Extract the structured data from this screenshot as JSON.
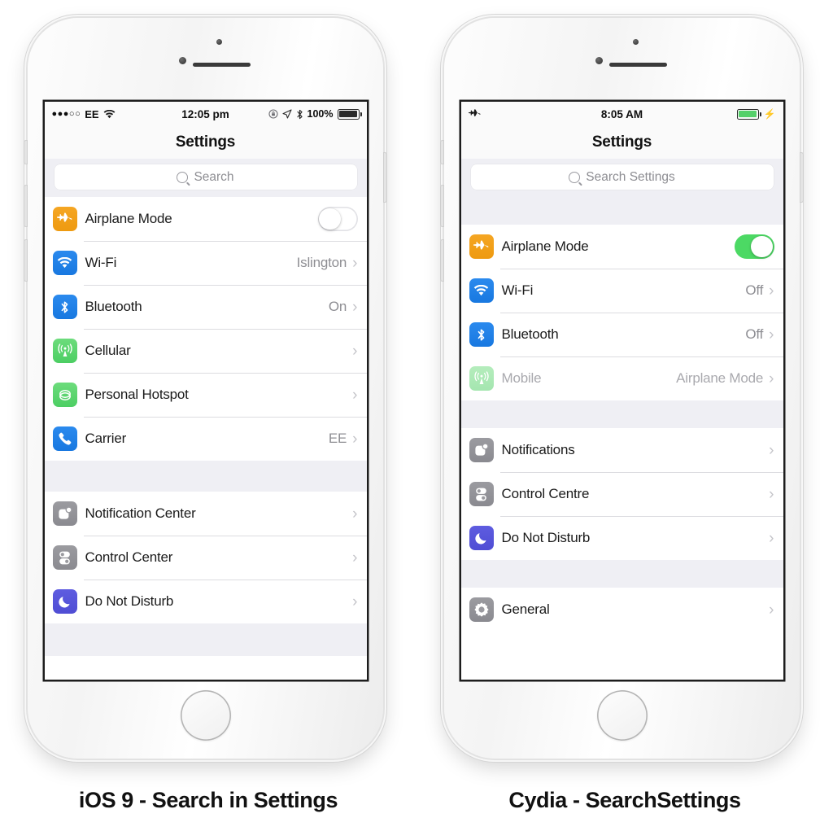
{
  "phones": [
    {
      "id": "left-phone",
      "caption": "iOS 9 - Search in Settings",
      "status_bar": {
        "signal_dots": "●●●○○",
        "carrier": "EE",
        "wifi_icon": "wifi-icon",
        "time": "12:05 pm",
        "rotation_lock_icon": "rotation-lock-icon",
        "location_icon": "location-arrow-icon",
        "bluetooth_icon": "bluetooth-icon",
        "battery_percent": "100%",
        "battery_icon": "battery-full-icon",
        "battery_color": "#2a2a2a",
        "charging": false
      },
      "nav_title": "Settings",
      "search": {
        "placeholder": "Search",
        "value": "",
        "icon": "search-icon"
      },
      "sections": [
        {
          "rows": [
            {
              "label": "Airplane Mode",
              "icon": "airplane-icon",
              "icon_color": "#f5a623",
              "control": "toggle",
              "toggle_on": false,
              "value": "",
              "chevron": false,
              "dim": false
            },
            {
              "label": "Wi-Fi",
              "icon": "wifi-icon",
              "icon_color": "#2b8aee",
              "control": "chevron",
              "value": "Islington",
              "chevron": true,
              "dim": false
            },
            {
              "label": "Bluetooth",
              "icon": "bluetooth-icon",
              "icon_color": "#2b8aee",
              "control": "chevron",
              "value": "On",
              "chevron": true,
              "dim": false
            },
            {
              "label": "Cellular",
              "icon": "cellular-antenna-icon",
              "icon_color": "#6ddc7c",
              "control": "chevron",
              "value": "",
              "chevron": true,
              "dim": false
            },
            {
              "label": "Personal Hotspot",
              "icon": "hotspot-link-icon",
              "icon_color": "#6ddc7c",
              "control": "chevron",
              "value": "",
              "chevron": true,
              "dim": false
            },
            {
              "label": "Carrier",
              "icon": "phone-handset-icon",
              "icon_color": "#2b8aee",
              "control": "chevron",
              "value": "EE",
              "chevron": true,
              "dim": false
            }
          ]
        },
        {
          "rows": [
            {
              "label": "Notification Center",
              "icon": "notifications-icon",
              "icon_color": "#9b9ba0",
              "control": "chevron",
              "value": "",
              "chevron": true,
              "dim": false
            },
            {
              "label": "Control Center",
              "icon": "control-center-icon",
              "icon_color": "#9b9ba0",
              "control": "chevron",
              "value": "",
              "chevron": true,
              "dim": false
            },
            {
              "label": "Do Not Disturb",
              "icon": "moon-icon",
              "icon_color": "#5e5ce0",
              "control": "chevron",
              "value": "",
              "chevron": true,
              "dim": false
            }
          ]
        }
      ]
    },
    {
      "id": "right-phone",
      "caption": "Cydia - SearchSettings",
      "status_bar": {
        "signal_dots": "",
        "carrier": "",
        "airplane_icon": "airplane-icon",
        "time": "8:05 AM",
        "battery_percent": "",
        "battery_icon": "battery-charging-icon",
        "battery_color": "#55d06a",
        "charging": true,
        "charging_icon": "lightning-bolt-icon"
      },
      "nav_title": "Settings",
      "search": {
        "placeholder": "Search Settings",
        "value": "",
        "icon": "search-icon"
      },
      "sections": [
        {
          "rows": [
            {
              "label": "Airplane Mode",
              "icon": "airplane-icon",
              "icon_color": "#f5a623",
              "control": "toggle",
              "toggle_on": true,
              "value": "",
              "chevron": false,
              "dim": false
            },
            {
              "label": "Wi-Fi",
              "icon": "wifi-icon",
              "icon_color": "#2b8aee",
              "control": "chevron",
              "value": "Off",
              "chevron": true,
              "dim": false
            },
            {
              "label": "Bluetooth",
              "icon": "bluetooth-icon",
              "icon_color": "#2b8aee",
              "control": "chevron",
              "value": "Off",
              "chevron": true,
              "dim": false
            },
            {
              "label": "Mobile",
              "icon": "cellular-antenna-icon",
              "icon_color": "#6ddc7c",
              "control": "chevron",
              "value": "Airplane Mode",
              "chevron": true,
              "dim": true
            }
          ]
        },
        {
          "rows": [
            {
              "label": "Notifications",
              "icon": "notifications-icon",
              "icon_color": "#9b9ba0",
              "control": "chevron",
              "value": "",
              "chevron": true,
              "dim": false
            },
            {
              "label": "Control Centre",
              "icon": "control-center-icon",
              "icon_color": "#9b9ba0",
              "control": "chevron",
              "value": "",
              "chevron": true,
              "dim": false
            },
            {
              "label": "Do Not Disturb",
              "icon": "moon-icon",
              "icon_color": "#5e5ce0",
              "control": "chevron",
              "value": "",
              "chevron": true,
              "dim": false
            }
          ]
        },
        {
          "rows": [
            {
              "label": "General",
              "icon": "gear-icon",
              "icon_color": "#9b9ba0",
              "control": "chevron",
              "value": "",
              "chevron": true,
              "dim": false
            }
          ]
        }
      ]
    }
  ],
  "colors": {
    "accent_green": "#4cd964",
    "orange": "#f5a623",
    "blue": "#2b8aee",
    "purple": "#5e5ce0",
    "grey": "#9b9ba0",
    "group_bg": "#efeff4",
    "value_text": "#8e8e93"
  }
}
